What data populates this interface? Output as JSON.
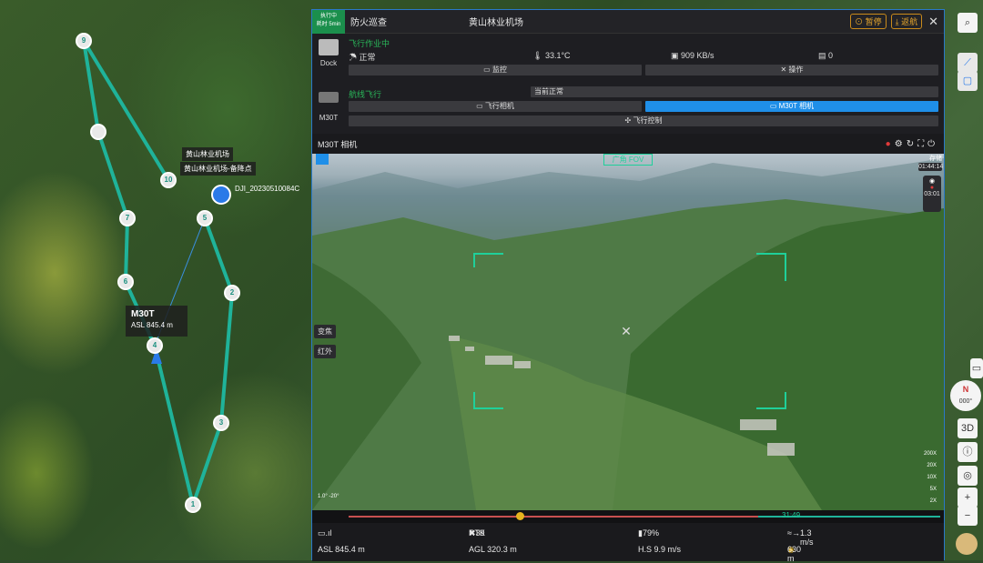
{
  "header": {
    "status_top": "执行中",
    "status_bottom": "耗时 5min",
    "mission": "防火巡查",
    "dock": "黄山林业机场",
    "pause": "暂停",
    "return": "返航",
    "close": "✕"
  },
  "dock": {
    "label": "Dock",
    "phase": "飞行作业中",
    "weather": "正常",
    "temp": "33.1°C",
    "speed": "909 KB/s",
    "count": "0",
    "monitor": "监控",
    "operate": "操作"
  },
  "drone": {
    "label": "M30T",
    "phase": "航线飞行",
    "status": "当前正常",
    "fly_cam": "飞行相机",
    "m30t_cam": "M30T 相机",
    "fly_ctrl": "飞行控制"
  },
  "video": {
    "title": "M30T 相机",
    "zoom_label": "广角 FOV",
    "time": "01:44:14",
    "rec": "03:01",
    "focus": "变焦",
    "ir": "红外",
    "zooms": [
      "200X",
      "20X",
      "10X",
      "5X",
      "2X"
    ],
    "storage": "存储",
    "gimbal": "1.0°  -20°"
  },
  "timeline": {
    "time": "31:49"
  },
  "telemetry": {
    "signal": "",
    "rtk": "RTK",
    "rtk_val": "39",
    "battery": "79%",
    "wind": "1.3 m/s",
    "asl": "ASL 845.4 m",
    "agl": "AGL 320.3 m",
    "hs": "H.S 9.9 m/s",
    "dist": "630 m"
  },
  "map": {
    "dock_label": "黄山林业机场",
    "dock_label2": "黄山林业机场-备降点",
    "dji_label": "DJI_20230510084C",
    "drone_name": "M30T",
    "drone_asl": "ASL 845.4 m",
    "waypoints": [
      "9",
      "1",
      "10",
      "7",
      "5",
      "6",
      "2",
      "4",
      "3",
      "1"
    ]
  },
  "tools": {
    "threed": "3D",
    "compass": "N",
    "compass_val": "000°"
  }
}
